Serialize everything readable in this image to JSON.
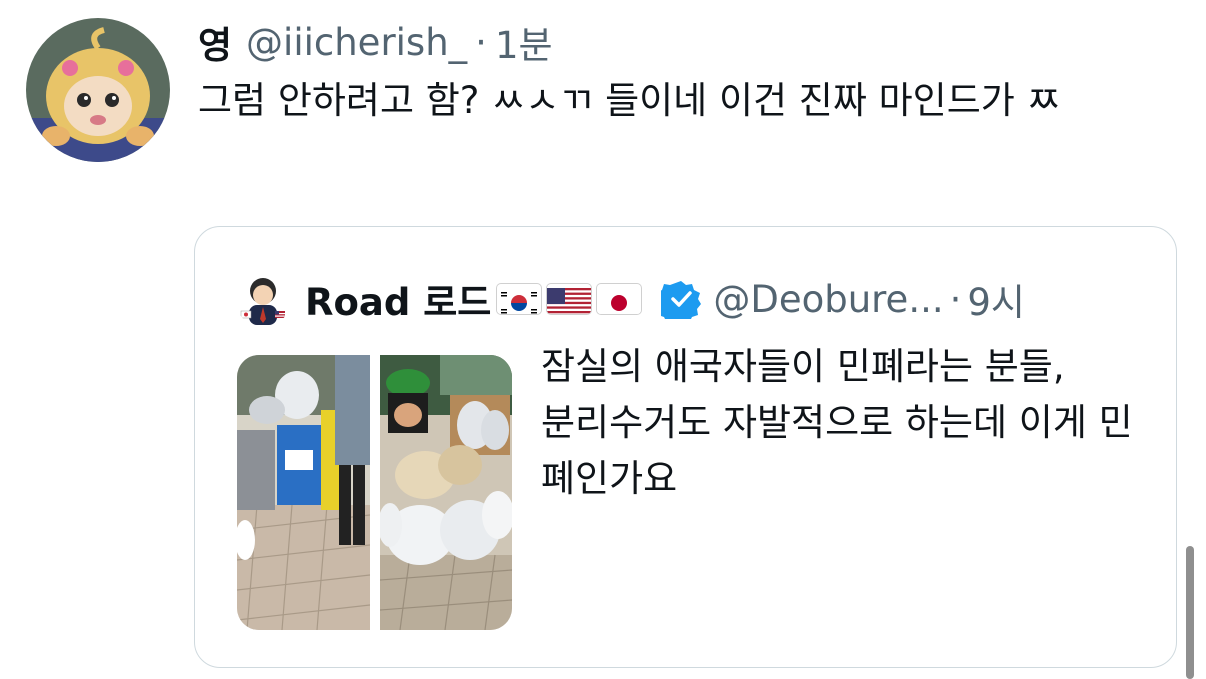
{
  "tweet": {
    "display_name": "영",
    "handle": "@iiicherish_",
    "separator": "·",
    "time": "1분",
    "text": "그럼 안하려고 함? ㅆㅅㄲ 들이네 이건 진짜 마인드가 ㅉ"
  },
  "quote": {
    "display_name": "Road 로드",
    "flags": [
      "south-korea-flag",
      "united-states-flag",
      "japan-flag"
    ],
    "verified_icon": "verified-badge-icon",
    "handle": "@Deobure...",
    "separator": "·",
    "time": "9시",
    "text": "잠실의 애국자들이 민폐라는 분들,\n분리수거도 자발적으로 하는데 이게 민폐인가요"
  },
  "colors": {
    "text_primary": "#0f1419",
    "text_secondary": "#536471",
    "border": "#cfd9de",
    "verified_blue": "#1d9bf0"
  }
}
